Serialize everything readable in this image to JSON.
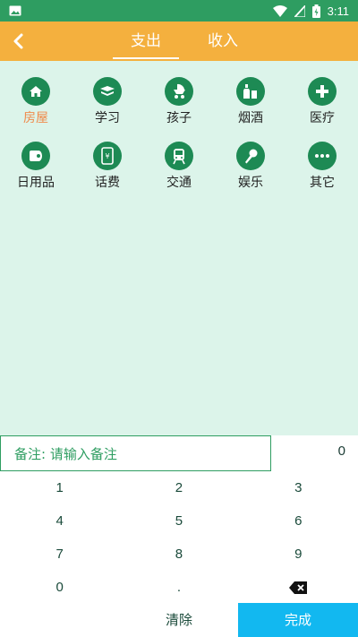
{
  "status_bar": {
    "time": "3:11",
    "icons": [
      "image-icon",
      "wifi-icon",
      "signal-icon",
      "battery-icon"
    ]
  },
  "header": {
    "back_icon": "chevron-left-icon",
    "tabs": [
      {
        "label": "支出",
        "active": true
      },
      {
        "label": "收入",
        "active": false
      }
    ]
  },
  "categories": [
    {
      "label": "房屋",
      "icon": "house-icon",
      "selected": true
    },
    {
      "label": "学习",
      "icon": "book-icon",
      "selected": false
    },
    {
      "label": "孩子",
      "icon": "stroller-icon",
      "selected": false
    },
    {
      "label": "烟酒",
      "icon": "bottle-icon",
      "selected": false
    },
    {
      "label": "医疗",
      "icon": "medical-cross-icon",
      "selected": false
    },
    {
      "label": "日用品",
      "icon": "toilet-paper-icon",
      "selected": false
    },
    {
      "label": "话费",
      "icon": "phone-icon",
      "selected": false
    },
    {
      "label": "交通",
      "icon": "train-icon",
      "selected": false
    },
    {
      "label": "娱乐",
      "icon": "microphone-icon",
      "selected": false
    },
    {
      "label": "其它",
      "icon": "more-icon",
      "selected": false
    }
  ],
  "note": {
    "placeholder": "备注: 请输入备注"
  },
  "amount": "0",
  "keypad": {
    "rows": [
      [
        "1",
        "2",
        "3"
      ],
      [
        "4",
        "5",
        "6"
      ],
      [
        "7",
        "8",
        "9"
      ],
      [
        "0",
        ".",
        ""
      ]
    ],
    "backspace_icon": "backspace-icon",
    "clear_label": "清除",
    "done_label": "完成"
  },
  "colors": {
    "status": "#2e9d61",
    "header": "#f4b03e",
    "area": "#dcf4ea",
    "icon_bg": "#1d8a54",
    "selected": "#f08a4b",
    "done": "#12b8f0"
  }
}
